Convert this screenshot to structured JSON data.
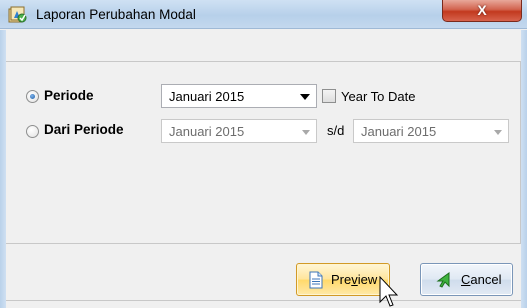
{
  "window": {
    "title": "Laporan Perubahan Modal",
    "close_label": "X"
  },
  "form": {
    "periode": {
      "label": "Periode",
      "selected": true,
      "value": "Januari 2015",
      "year_to_date_label": "Year To Date",
      "year_to_date_checked": false
    },
    "dari_periode": {
      "label": "Dari Periode",
      "selected": false,
      "from_value": "Januari 2015",
      "separator": "s/d",
      "to_value": "Januari 2015"
    }
  },
  "buttons": {
    "preview": {
      "mnemonic_prefix": "Pre",
      "mnemonic": "v",
      "suffix": "iew",
      "icon": "document-icon"
    },
    "cancel": {
      "mnemonic_prefix": "",
      "mnemonic": "C",
      "suffix": "ancel",
      "icon": "green-arrow-icon"
    }
  },
  "colors": {
    "preview_button": "#ffe59a",
    "close_button": "#c2391e",
    "titlebar": "#b7d0ea"
  }
}
